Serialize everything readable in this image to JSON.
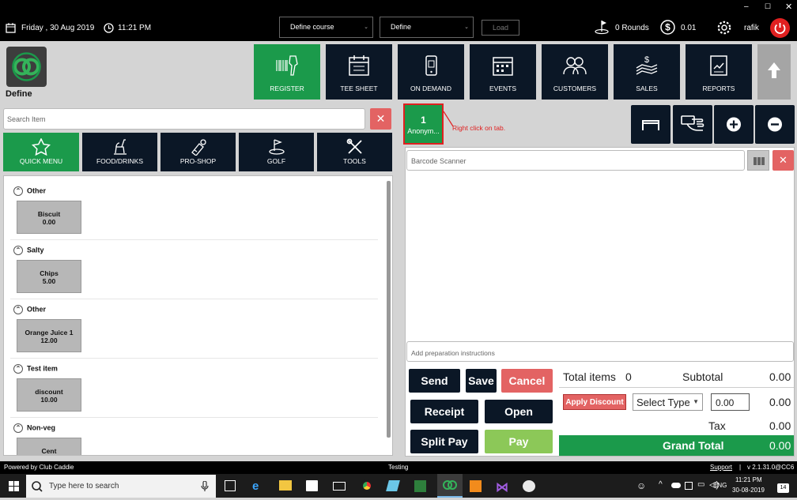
{
  "topbar": {
    "date": "Friday ,  30 Aug 2019",
    "time": "11:21 PM",
    "course_select": "Define course",
    "define_select": "Define",
    "load_button": "Load",
    "rounds": "0 Rounds",
    "balance": "0.01",
    "user": "rafik"
  },
  "brand": {
    "name": "Define"
  },
  "nav": [
    {
      "label": "REGISTER",
      "icon": "barcode-scanner-icon",
      "active": true
    },
    {
      "label": "TEE SHEET",
      "icon": "calendar-icon"
    },
    {
      "label": "ON DEMAND",
      "icon": "mobile-phone-icon"
    },
    {
      "label": "EVENTS",
      "icon": "events-calendar-icon"
    },
    {
      "label": "CUSTOMERS",
      "icon": "customers-icon"
    },
    {
      "label": "SALES",
      "icon": "sales-icon"
    },
    {
      "label": "REPORTS",
      "icon": "reports-icon"
    }
  ],
  "search": {
    "placeholder": "Search Item"
  },
  "categories": [
    {
      "label": "QUICK MENU",
      "icon": "star-icon",
      "active": true
    },
    {
      "label": "FOOD/DRINKS",
      "icon": "food-drinks-icon"
    },
    {
      "label": "PRO-SHOP",
      "icon": "pro-shop-icon"
    },
    {
      "label": "GOLF",
      "icon": "golf-icon"
    },
    {
      "label": "TOOLS",
      "icon": "tools-icon"
    }
  ],
  "groups": [
    {
      "name": "Other",
      "item": "Biscuit",
      "price": "0.00"
    },
    {
      "name": "Salty",
      "item": "Chips",
      "price": "5.00"
    },
    {
      "name": "Other",
      "item": "Orange Juice 1",
      "price": "12.00"
    },
    {
      "name": "Test item",
      "item": "discount",
      "price": "10.00"
    },
    {
      "name": "Non-veg",
      "item": "Cent",
      "price": ""
    }
  ],
  "tab": {
    "number": "1",
    "name": "Anonym...",
    "annotation": "Right click on tab."
  },
  "barcode": {
    "placeholder": "Barcode Scanner"
  },
  "prep": {
    "placeholder": "Add preparation instructions"
  },
  "actions": {
    "send": "Send",
    "save": "Save",
    "cancel": "Cancel",
    "receipt": "Receipt",
    "open": "Open",
    "split_pay": "Split Pay",
    "pay": "Pay",
    "apply_discount": "Apply Discount"
  },
  "totals": {
    "total_items_label": "Total items",
    "total_items": "0",
    "subtotal_label": "Subtotal",
    "subtotal": "0.00",
    "select_type": "Select Type",
    "discount_input": "0.00",
    "discount_value": "0.00",
    "tax_label": "Tax",
    "tax": "0.00",
    "grand_total_label": "Grand Total",
    "grand_total": "0.00"
  },
  "status": {
    "powered": "Powered by Club Caddie",
    "env": "Testing",
    "support": "Support",
    "version": "v 2.1.31.0@CC6"
  },
  "taskbar": {
    "search_placeholder": "Type here to search",
    "lang": "ENG",
    "time": "11:21 PM",
    "date": "30-08-2019",
    "notif": "14"
  },
  "colors": {
    "green": "#1b9a4b",
    "navy": "#0b1726",
    "red": "#e36363",
    "pay_green": "#8cc858"
  }
}
